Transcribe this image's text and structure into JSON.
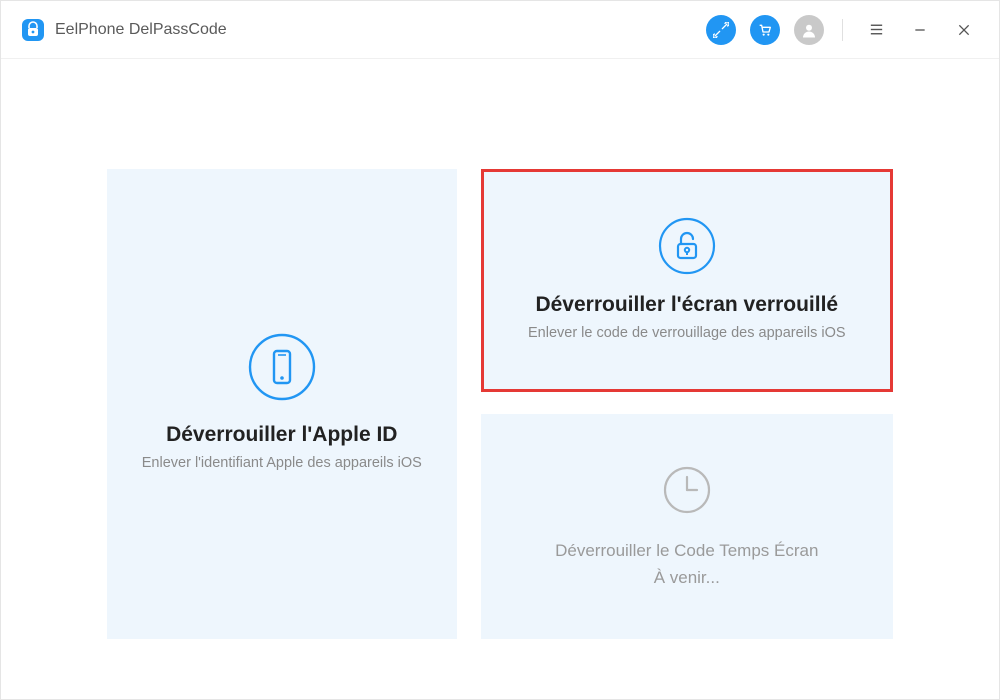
{
  "app": {
    "title": "EelPhone DelPassCode"
  },
  "cards": {
    "appleId": {
      "title": "Déverrouiller l'Apple ID",
      "subtitle": "Enlever l'identifiant Apple des appareils iOS"
    },
    "lockScreen": {
      "title": "Déverrouiller l'écran verrouillé",
      "subtitle": "Enlever le code de verrouillage des appareils iOS"
    },
    "screenTime": {
      "line1": "Déverrouiller le Code Temps Écran",
      "line2": "À venir..."
    }
  }
}
